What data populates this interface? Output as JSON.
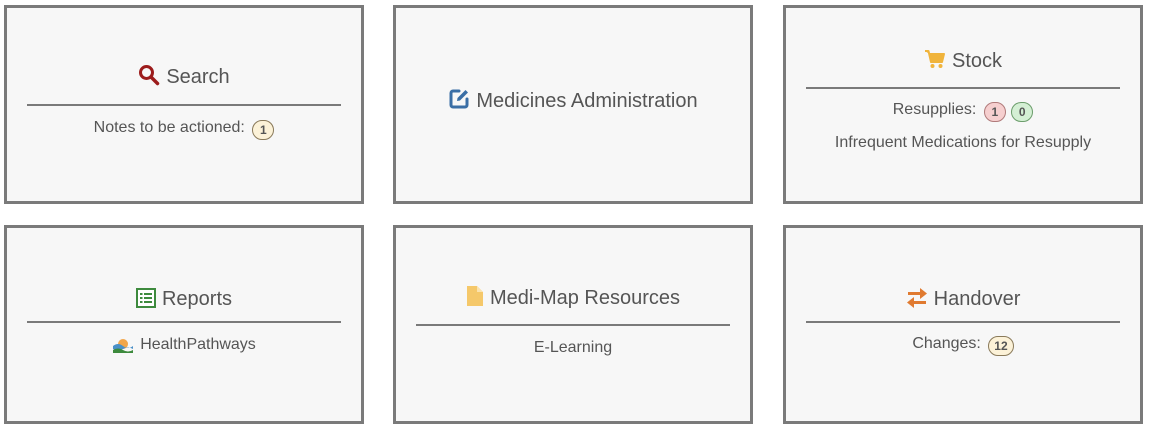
{
  "tiles": {
    "search": {
      "title": "Search",
      "icon": "search-icon",
      "notes_label": "Notes to be actioned:",
      "notes_count": "1"
    },
    "medicines": {
      "title": "Medicines Administration",
      "icon": "edit-icon"
    },
    "stock": {
      "title": "Stock",
      "icon": "cart-icon",
      "resupplies_label": "Resupplies:",
      "resupplies_red": "1",
      "resupplies_green": "0",
      "infrequent_link": "Infrequent Medications for Resupply"
    },
    "reports": {
      "title": "Reports",
      "icon": "list-table-icon",
      "healthpathways_label": "HealthPathways",
      "healthpathways_icon": "healthpathways-logo-icon"
    },
    "resources": {
      "title": "Medi-Map Resources",
      "icon": "document-icon",
      "elearning_label": "E-Learning"
    },
    "handover": {
      "title": "Handover",
      "icon": "exchange-arrows-icon",
      "changes_label": "Changes:",
      "changes_count": "12"
    }
  },
  "colors": {
    "search_icon": "#9c1c1c",
    "edit_icon": "#3a6ea5",
    "cart_icon": "#f0b43c",
    "reports_icon": "#3d8a3d",
    "document_icon": "#f5c86a",
    "handover_icon": "#e07a30",
    "tile_border": "#7a7a7a",
    "tile_background": "#f7f7f7"
  }
}
